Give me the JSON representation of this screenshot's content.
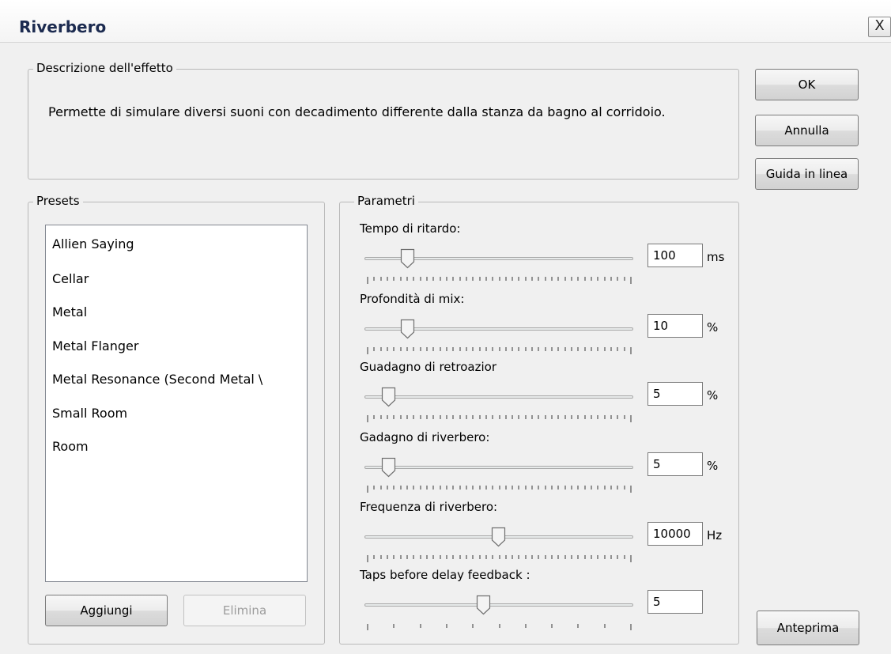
{
  "window": {
    "title": "Riverbero",
    "close_glyph": "X"
  },
  "description": {
    "legend": "Descrizione dell'effetto",
    "text": "Permette di simulare diversi suoni con decadimento differente dalla stanza da bagno al corridoio."
  },
  "buttons": {
    "ok": "OK",
    "cancel": "Annulla",
    "help": "Guida in linea",
    "preview": "Anteprima"
  },
  "presets": {
    "legend": "Presets",
    "items": [
      "Allien Saying",
      "Cellar",
      "Metal",
      "Metal Flanger",
      "Metal Resonance (Second Metal \\",
      "Small Room",
      "Room"
    ],
    "add": "Aggiungi",
    "delete": "Elimina"
  },
  "params": {
    "legend": "Parametri",
    "items": [
      {
        "label": "Tempo di ritardo:",
        "value": "100",
        "unit": "ms",
        "fraction": 0.13
      },
      {
        "label": "Profondità di mix:",
        "value": "10",
        "unit": "%",
        "fraction": 0.13
      },
      {
        "label": "Guadagno di retroazior",
        "value": "5",
        "unit": "%",
        "fraction": 0.05
      },
      {
        "label": "Gadagno di riverbero:",
        "value": "5",
        "unit": "%",
        "fraction": 0.05
      },
      {
        "label": "Frequenza di riverbero:",
        "value": "10000",
        "unit": "Hz",
        "fraction": 0.5
      },
      {
        "label": "Taps before delay feedback :",
        "value": "5",
        "unit": "",
        "fraction": 0.44
      }
    ]
  }
}
